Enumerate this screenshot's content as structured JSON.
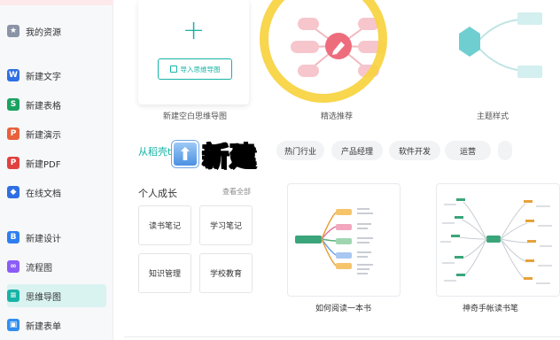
{
  "sidebar": {
    "items": [
      {
        "label": "我的资源",
        "icon": "star-folder-icon",
        "color": "#8a94a6",
        "glyph": "★"
      },
      {
        "label": "新建文字",
        "icon": "word-doc-icon",
        "color": "#2f6fe4",
        "glyph": "W"
      },
      {
        "label": "新建表格",
        "icon": "sheet-icon",
        "color": "#1aa260",
        "glyph": "S"
      },
      {
        "label": "新建演示",
        "icon": "slides-icon",
        "color": "#e8603c",
        "glyph": "P"
      },
      {
        "label": "新建PDF",
        "icon": "pdf-icon",
        "color": "#e0413f",
        "glyph": "P"
      },
      {
        "label": "在线文档",
        "icon": "cloud-doc-icon",
        "color": "#2f6fe4",
        "glyph": "◆"
      },
      {
        "label": "新建设计",
        "icon": "design-icon",
        "color": "#2f7ef0",
        "glyph": "B"
      },
      {
        "label": "流程图",
        "icon": "flowchart-icon",
        "color": "#8b5cf6",
        "glyph": "∞"
      },
      {
        "label": "思维导图",
        "icon": "mindmap-icon",
        "color": "#17b3a6",
        "glyph": "≡"
      },
      {
        "label": "新建表单",
        "icon": "form-icon",
        "color": "#2f8ef0",
        "glyph": "▣"
      }
    ]
  },
  "top_cards": {
    "blank_caption": "新建空白思维导图",
    "import_label": "导入思维导图",
    "recommend_caption": "精选推荐",
    "theme_caption": "主题样式"
  },
  "overlay_text": "新建",
  "categories": {
    "label": "从稻壳t",
    "chips": [
      "热门行业",
      "产品经理",
      "软件开发",
      "运营"
    ]
  },
  "personal": {
    "title": "个人成长",
    "see_all": "查看全部",
    "tags": [
      "读书笔记",
      "学习笔记",
      "知识管理",
      "学校教育"
    ]
  },
  "templates": [
    {
      "caption": "如何阅读一本书"
    },
    {
      "caption": "神奇手帐读书笔"
    }
  ],
  "colors": {
    "accent": "#17b3a6",
    "highlight_ring": "#f7d23e"
  }
}
